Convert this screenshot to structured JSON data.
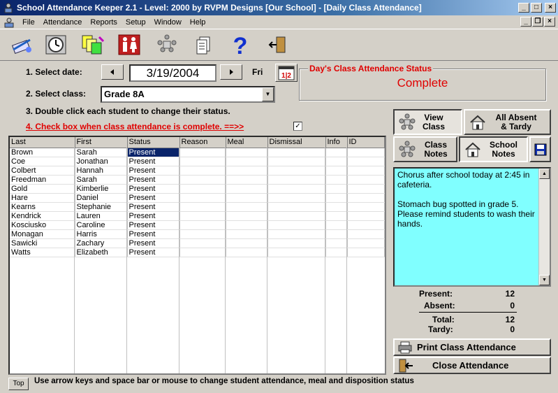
{
  "window": {
    "title": "School Attendance Keeper 2.1 - Level: 2000 by RVPM Designs [Our School] - [Daily Class Attendance]"
  },
  "menu": [
    "File",
    "Attendance",
    "Reports",
    "Setup",
    "Window",
    "Help"
  ],
  "toolbar_icons": [
    "daily-attendance-icon",
    "clock-icon",
    "reports-icon",
    "restroom-icon",
    "students-icon",
    "notes-icon",
    "help-icon",
    "exit-icon"
  ],
  "steps": {
    "select_date": "1. Select date:",
    "select_class": "2. Select class:",
    "double_click": "3. Double click each student to change their status.",
    "check_box": "4.  Check box when class attendance is complete.  ==>>"
  },
  "date": {
    "value": "3/19/2004",
    "weekday": "Fri",
    "complete_checked": "✓"
  },
  "class_select": {
    "value": "Grade 8A"
  },
  "status_frame": {
    "legend": "Day's Class Attendance Status",
    "value": "Complete"
  },
  "table": {
    "columns": [
      "Last",
      "First",
      "Status",
      "Reason",
      "Meal",
      "Dismissal",
      "Info",
      "ID"
    ],
    "rows": [
      [
        "Brown",
        "Sarah",
        "Present",
        "",
        "",
        "",
        "",
        ""
      ],
      [
        "Coe",
        "Jonathan",
        "Present",
        "",
        "",
        "",
        "",
        ""
      ],
      [
        "Colbert",
        "Hannah",
        "Present",
        "",
        "",
        "",
        "",
        ""
      ],
      [
        "Freedman",
        "Sarah",
        "Present",
        "",
        "",
        "",
        "",
        ""
      ],
      [
        "Gold",
        "Kimberlie",
        "Present",
        "",
        "",
        "",
        "",
        ""
      ],
      [
        "Hare",
        "Daniel",
        "Present",
        "",
        "",
        "",
        "",
        ""
      ],
      [
        "Kearns",
        "Stephanie",
        "Present",
        "",
        "",
        "",
        "",
        ""
      ],
      [
        "Kendrick",
        "Lauren",
        "Present",
        "",
        "",
        "",
        "",
        ""
      ],
      [
        "Kosciusko",
        "Caroline",
        "Present",
        "",
        "",
        "",
        "",
        ""
      ],
      [
        "Monagan",
        "Harris",
        "Present",
        "",
        "",
        "",
        "",
        ""
      ],
      [
        "Sawicki",
        "Zachary",
        "Present",
        "",
        "",
        "",
        "",
        ""
      ],
      [
        "Watts",
        "Elizabeth",
        "Present",
        "",
        "",
        "",
        "",
        ""
      ]
    ]
  },
  "buttons": {
    "view_class": "View Class",
    "all_absent": "All Absent & Tardy",
    "class_notes": "Class Notes",
    "school_notes": "School Notes",
    "print": "Print Class Attendance",
    "close": "Close Attendance"
  },
  "notes": {
    "para1": "Chorus after school today at 2:45 in cafeteria.",
    "para2": "Stomach bug spotted in grade 5. Please remind students to wash their hands."
  },
  "stats": {
    "present_label": "Present:",
    "present": "12",
    "absent_label": "Absent:",
    "absent": "0",
    "total_label": "Total:",
    "total": "12",
    "tardy_label": "Tardy:",
    "tardy": "0"
  },
  "footer": {
    "top_button": "Top",
    "hint": "Use arrow keys and space bar or mouse to change student attendance, meal and disposition status"
  },
  "colors": {
    "status_red": "#e00000",
    "notes_bg": "#80ffff",
    "selection": "#0a246a"
  }
}
